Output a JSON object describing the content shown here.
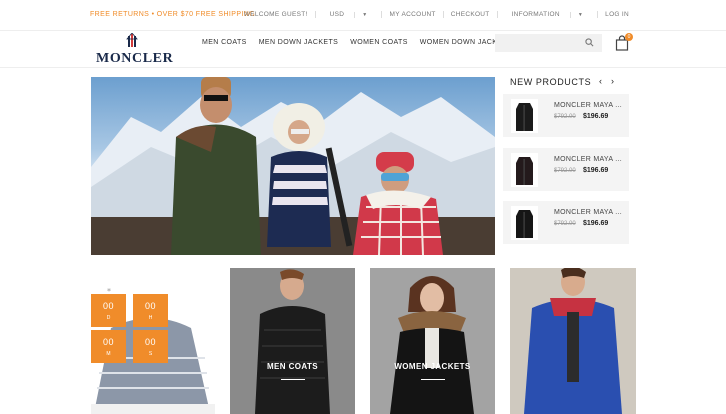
{
  "topbar": {
    "promo": "FREE RETURNS • OVER $70 FREE SHIPPING",
    "welcome": "WELCOME GUEST!",
    "currency": "USD",
    "my_account": "MY ACCOUNT",
    "checkout": "CHECKOUT",
    "information": "INFORMATION",
    "login": "LOG IN"
  },
  "header": {
    "logo_text": "MONCLER",
    "nav": [
      "MEN COATS",
      "MEN DOWN JACKETS",
      "WOMEN COATS",
      "WOMEN DOWN JACKETS"
    ],
    "cart_count": "0",
    "icons": {
      "search": "search-icon",
      "cart": "shopping-bag-icon"
    }
  },
  "new_products": {
    "title": "NEW PRODUCTS",
    "items": [
      {
        "name": "MONCLER MAYA ...",
        "old_price": "$792.00",
        "price": "$196.69"
      },
      {
        "name": "MONCLER MAYA ...",
        "old_price": "$792.00",
        "price": "$196.69"
      },
      {
        "name": "MONCLER MAYA ...",
        "old_price": "$792.00",
        "price": "$196.69"
      }
    ]
  },
  "countdown": {
    "boxes": [
      {
        "value": "00",
        "unit": "D"
      },
      {
        "value": "00",
        "unit": "H"
      },
      {
        "value": "00",
        "unit": "M"
      },
      {
        "value": "00",
        "unit": "S"
      }
    ]
  },
  "tiles": [
    {
      "label": "MEN COATS"
    },
    {
      "label": "WOMEN JACKETS"
    }
  ],
  "colors": {
    "accent": "#f08c2a",
    "logo": "#1a2a4a"
  }
}
